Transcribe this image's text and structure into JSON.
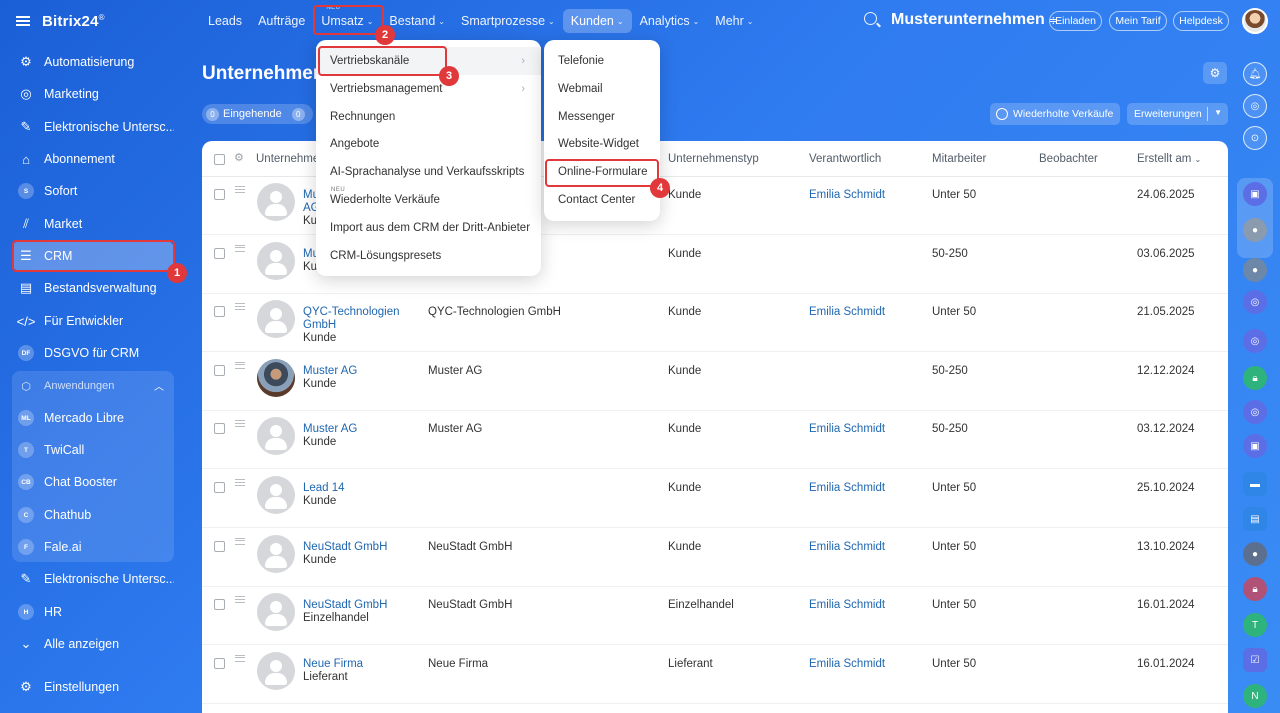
{
  "app": {
    "logo": "Bitrix24",
    "logo_mark": "®"
  },
  "sidebar": {
    "items": [
      {
        "label": "Automatisierung",
        "icon": "automation-icon",
        "glyph": "⚙"
      },
      {
        "label": "Marketing",
        "icon": "marketing-icon",
        "glyph": "◎"
      },
      {
        "label": "Elektronische Untersc...",
        "icon": "e-signature-icon",
        "glyph": "✎"
      },
      {
        "label": "Abonnement",
        "icon": "subscription-icon",
        "glyph": "⌂"
      },
      {
        "label": "Sofort",
        "icon": "sofort-icon",
        "glyph": "S"
      },
      {
        "label": "Market",
        "icon": "market-icon",
        "glyph": "⫽"
      },
      {
        "label": "CRM",
        "icon": "crm-icon",
        "glyph": "☰"
      },
      {
        "label": "Bestandsverwaltung",
        "icon": "inventory-icon",
        "glyph": "▤"
      },
      {
        "label": "Für Entwickler",
        "icon": "developer-icon",
        "glyph": "</>"
      },
      {
        "label": "DSGVO für CRM",
        "icon": "gdpr-icon",
        "glyph": "DF"
      }
    ],
    "apps_header": "Anwendungen",
    "apps": [
      {
        "label": "Mercado Libre",
        "abbr": "ML"
      },
      {
        "label": "TwiCall",
        "abbr": "T"
      },
      {
        "label": "Chat Booster",
        "abbr": "CB"
      },
      {
        "label": "Chathub",
        "abbr": "C"
      },
      {
        "label": "Fale.ai",
        "abbr": "F"
      }
    ],
    "bottom": [
      {
        "label": "Elektronische Untersc...",
        "glyph": "✎"
      },
      {
        "label": "HR",
        "glyph": "H"
      },
      {
        "label": "Alle anzeigen",
        "glyph": "⌄"
      },
      {
        "label": "Einstellungen",
        "glyph": "⚙"
      }
    ]
  },
  "topnav": {
    "items": [
      "Leads",
      "Aufträge",
      "Umsatz",
      "Bestand",
      "Smartprozesse",
      "Kunden",
      "Analytics",
      "Mehr"
    ],
    "umsatz_tag": "NEU",
    "company": "Musterunternehmen",
    "company_icon": "≑",
    "pills": [
      "Einladen",
      "Mein Tarif",
      "Helpdesk"
    ]
  },
  "page": {
    "title": "Unternehmen",
    "counter": {
      "num": "0",
      "label": "Eingehende"
    },
    "counter2_num": "0",
    "buttons": {
      "wiederholte": "Wiederholte Verkäufe",
      "erweiterungen": "Erweiterungen"
    }
  },
  "table": {
    "headers": [
      "Unternehme",
      "Unternehmenstyp",
      "Verantwortlich",
      "Mitarbeiter",
      "Beobachter",
      "Erstellt am"
    ],
    "rows": [
      {
        "name1": "Mu",
        "name2": "AG",
        "sub": "Ku",
        "company": "",
        "type": "Kunde",
        "resp": "Emilia Schmidt",
        "emp": "Unter 50",
        "date": "24.06.2025"
      },
      {
        "name1": "Mu",
        "name2": "",
        "sub": "Kun",
        "company": "",
        "type": "Kunde",
        "resp": "",
        "emp": "50-250",
        "date": "03.06.2025"
      },
      {
        "name1": "QYC-Technologien",
        "name2": "GmbH",
        "sub": "Kunde",
        "company": "QYC-Technologien GmbH",
        "type": "Kunde",
        "resp": "Emilia Schmidt",
        "emp": "Unter 50",
        "date": "21.05.2025"
      },
      {
        "name1": "Muster AG",
        "name2": "",
        "sub": "Kunde",
        "company": "Muster AG",
        "type": "Kunde",
        "resp": "",
        "emp": "50-250",
        "date": "12.12.2024"
      },
      {
        "name1": "Muster AG",
        "name2": "",
        "sub": "Kunde",
        "company": "Muster AG",
        "type": "Kunde",
        "resp": "Emilia Schmidt",
        "emp": "50-250",
        "date": "03.12.2024"
      },
      {
        "name1": "Lead 14",
        "name2": "",
        "sub": "Kunde",
        "company": "",
        "type": "Kunde",
        "resp": "Emilia Schmidt",
        "emp": "Unter 50",
        "date": "25.10.2024"
      },
      {
        "name1": "NeuStadt GmbH",
        "name2": "",
        "sub": "Kunde",
        "company": "NeuStadt GmbH",
        "type": "Kunde",
        "resp": "Emilia Schmidt",
        "emp": "Unter 50",
        "date": "13.10.2024"
      },
      {
        "name1": "NeuStadt GmbH",
        "name2": "",
        "sub": "Einzelhandel",
        "company": "NeuStadt GmbH",
        "type": "Einzelhandel",
        "resp": "Emilia Schmidt",
        "emp": "Unter 50",
        "date": "16.01.2024"
      },
      {
        "name1": "Neue Firma",
        "name2": "",
        "sub": "Lieferant",
        "company": "Neue Firma",
        "type": "Lieferant",
        "resp": "Emilia Schmidt",
        "emp": "Unter 50",
        "date": "16.01.2024"
      }
    ]
  },
  "umsatz_menu": {
    "items": [
      "Vertriebskanäle",
      "Vertriebsmanagement",
      "Rechnungen",
      "Angebote",
      "AI-Sprachanalyse und Verkaufsskripts",
      "Wiederholte Verkäufe",
      "Import aus dem CRM der Dritt-Anbieter",
      "CRM-Lösungspresets"
    ],
    "neu_tag": "NEU"
  },
  "channels_menu": {
    "items": [
      "Telefonie",
      "Webmail",
      "Messenger",
      "Website-Widget",
      "Online-Formulare",
      "Contact Center"
    ]
  },
  "badges": [
    "1",
    "2",
    "3",
    "4"
  ],
  "highlight_color": "#e0383b"
}
